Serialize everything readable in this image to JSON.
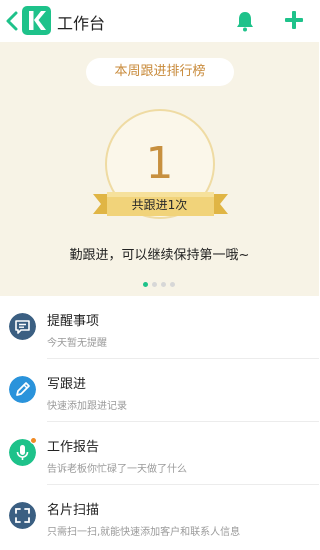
{
  "header": {
    "title": "工作台",
    "icons": [
      "back-icon",
      "app-logo",
      "bell-icon",
      "plus-icon"
    ],
    "accent_color": "#1ec28a"
  },
  "hero": {
    "rank_label": "本周跟进排行榜",
    "rank_number": "1",
    "ribbon_text": "共跟进1次",
    "message": "勤跟进，可以继续保持第一哦~",
    "page_count": 4,
    "active_page": 1,
    "background_color": "#f7f3e6",
    "gold_color": "#c7903f"
  },
  "items": [
    {
      "title": "提醒事项",
      "subtitle": "今天暂无提醒",
      "icon": "chat-icon",
      "icon_color": "#3b5f82"
    },
    {
      "title": "写跟进",
      "subtitle": "快速添加跟进记录",
      "icon": "pen-icon",
      "icon_color": "#2a93db"
    },
    {
      "title": "工作报告",
      "subtitle": "告诉老板你忙碌了一天做了什么",
      "icon": "microphone-icon",
      "icon_color": "#1ec28a"
    },
    {
      "title": "名片扫描",
      "subtitle": "只需扫一扫,就能快速添加客户和联系人信息",
      "icon": "scan-icon",
      "icon_color": "#3b5f82"
    }
  ]
}
